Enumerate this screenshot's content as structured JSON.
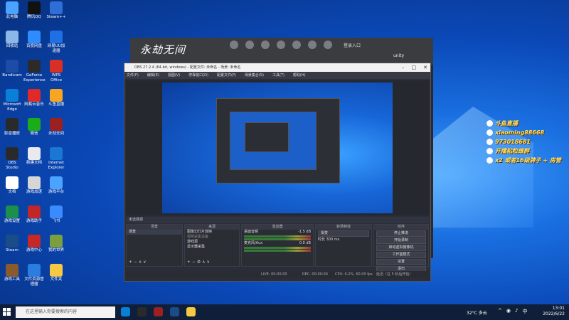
{
  "desktop_icons": [
    {
      "label": "此电脑",
      "color": "#4aa3ff"
    },
    {
      "label": "腾讯QQ",
      "color": "#111111"
    },
    {
      "label": "Steam++",
      "color": "#2d6fd6"
    },
    {
      "label": "回收站",
      "color": "#8bb8e8"
    },
    {
      "label": "百度网盘",
      "color": "#2f8cff"
    },
    {
      "label": "网易UU加速器",
      "color": "#1f6fe5"
    },
    {
      "label": "Bandicam",
      "color": "#1c4ca8"
    },
    {
      "label": "GeForce Experience",
      "color": "#2b2b2b"
    },
    {
      "label": "WPS Office",
      "color": "#d93025"
    },
    {
      "label": "Microsoft Edge",
      "color": "#0a7fd8"
    },
    {
      "label": "网易云音乐",
      "color": "#e02a2a"
    },
    {
      "label": "斗鱼直播",
      "color": "#f5a623"
    },
    {
      "label": "影音播放",
      "color": "#2a2a2a"
    },
    {
      "label": "微信",
      "color": "#1aad19"
    },
    {
      "label": "永劫无间",
      "color": "#9b2020"
    },
    {
      "label": "OBS Studio",
      "color": "#2a2a2a"
    },
    {
      "label": "新建文档",
      "color": "#e8eaf0"
    },
    {
      "label": "Internet Explorer",
      "color": "#1a77d2"
    },
    {
      "label": "文档",
      "color": "#ffffff"
    },
    {
      "label": "游戏加速",
      "color": "#d6d6d6"
    },
    {
      "label": "游戏平台",
      "color": "#4aa3ff"
    },
    {
      "label": "游戏设置",
      "color": "#1b8f4c"
    },
    {
      "label": "游戏助手",
      "color": "#c12727"
    },
    {
      "label": "飞书",
      "color": "#3a8bff"
    },
    {
      "label": "Steam",
      "color": "#1b4c8a"
    },
    {
      "label": "游戏中心",
      "color": "#c62828"
    },
    {
      "label": "我的世界",
      "color": "#7b9e3e"
    },
    {
      "label": "游戏工具",
      "color": "#8b5a2b"
    },
    {
      "label": "文件资源管理器",
      "color": "#2a7de1"
    },
    {
      "label": "文件夹",
      "color": "#f6c945"
    }
  ],
  "game_window": {
    "logo": "永劫无间",
    "login_text": "登录入口",
    "unity_text": "unity"
  },
  "obs": {
    "title": "OBS 27.2.4 (64-bit, windows) - 配置文件: 未命名 - 场景: 未命名",
    "menu": [
      "文件(F)",
      "编辑(E)",
      "视图(V)",
      "停靠窗口(D)",
      "配置文件(P)",
      "场景集合(S)",
      "工具(T)",
      "帮助(H)"
    ],
    "scene_label": "未选择源",
    "docks": {
      "scenes": {
        "title": "场景",
        "items": [
          "场景"
        ]
      },
      "sources": {
        "title": "来源",
        "items": [
          "图像幻灯片放映",
          "视频采集设备",
          "游戏源",
          "显示器采集"
        ]
      },
      "mixer": {
        "title": "混音器",
        "tracks": [
          {
            "name": "桌面音频",
            "db": "-1.5 dB"
          },
          {
            "name": "麦克风/Aux",
            "db": "0.0 dB"
          }
        ]
      },
      "transitions": {
        "title": "转场特效",
        "mode": "渐变",
        "duration_label": "时长",
        "duration": "300 ms"
      },
      "controls": {
        "title": "控件",
        "buttons": [
          "停止推流",
          "开始录制",
          "启动虚拟摄像机",
          "工作室模式",
          "设置",
          "退出"
        ]
      }
    },
    "status": {
      "live": "LIVE: 00:00:00",
      "rec": "REC: 00:00:00",
      "cpu": "CPU: 0.2%, 60.00 fps",
      "delay": "延迟（在 5 秒后开始）"
    }
  },
  "overlay": {
    "lines": [
      "斗鱼直播",
      "xiaoming88668",
      "973018681",
      "开播粘粒维群",
      "x2 或者16级牌子 + 房管"
    ]
  },
  "taskbar": {
    "search_placeholder": "在这里输入你要搜索的内容",
    "weather": "32°C 多云",
    "time": "13:01",
    "date": "2022/6/22",
    "lang": "中",
    "apps": [
      {
        "name": "edge",
        "color": "#0a7fd8"
      },
      {
        "name": "obs",
        "color": "#2a2a2a"
      },
      {
        "name": "game",
        "color": "#9b2020"
      },
      {
        "name": "steam",
        "color": "#1b4c8a"
      },
      {
        "name": "explorer",
        "color": "#f6c945"
      }
    ]
  }
}
